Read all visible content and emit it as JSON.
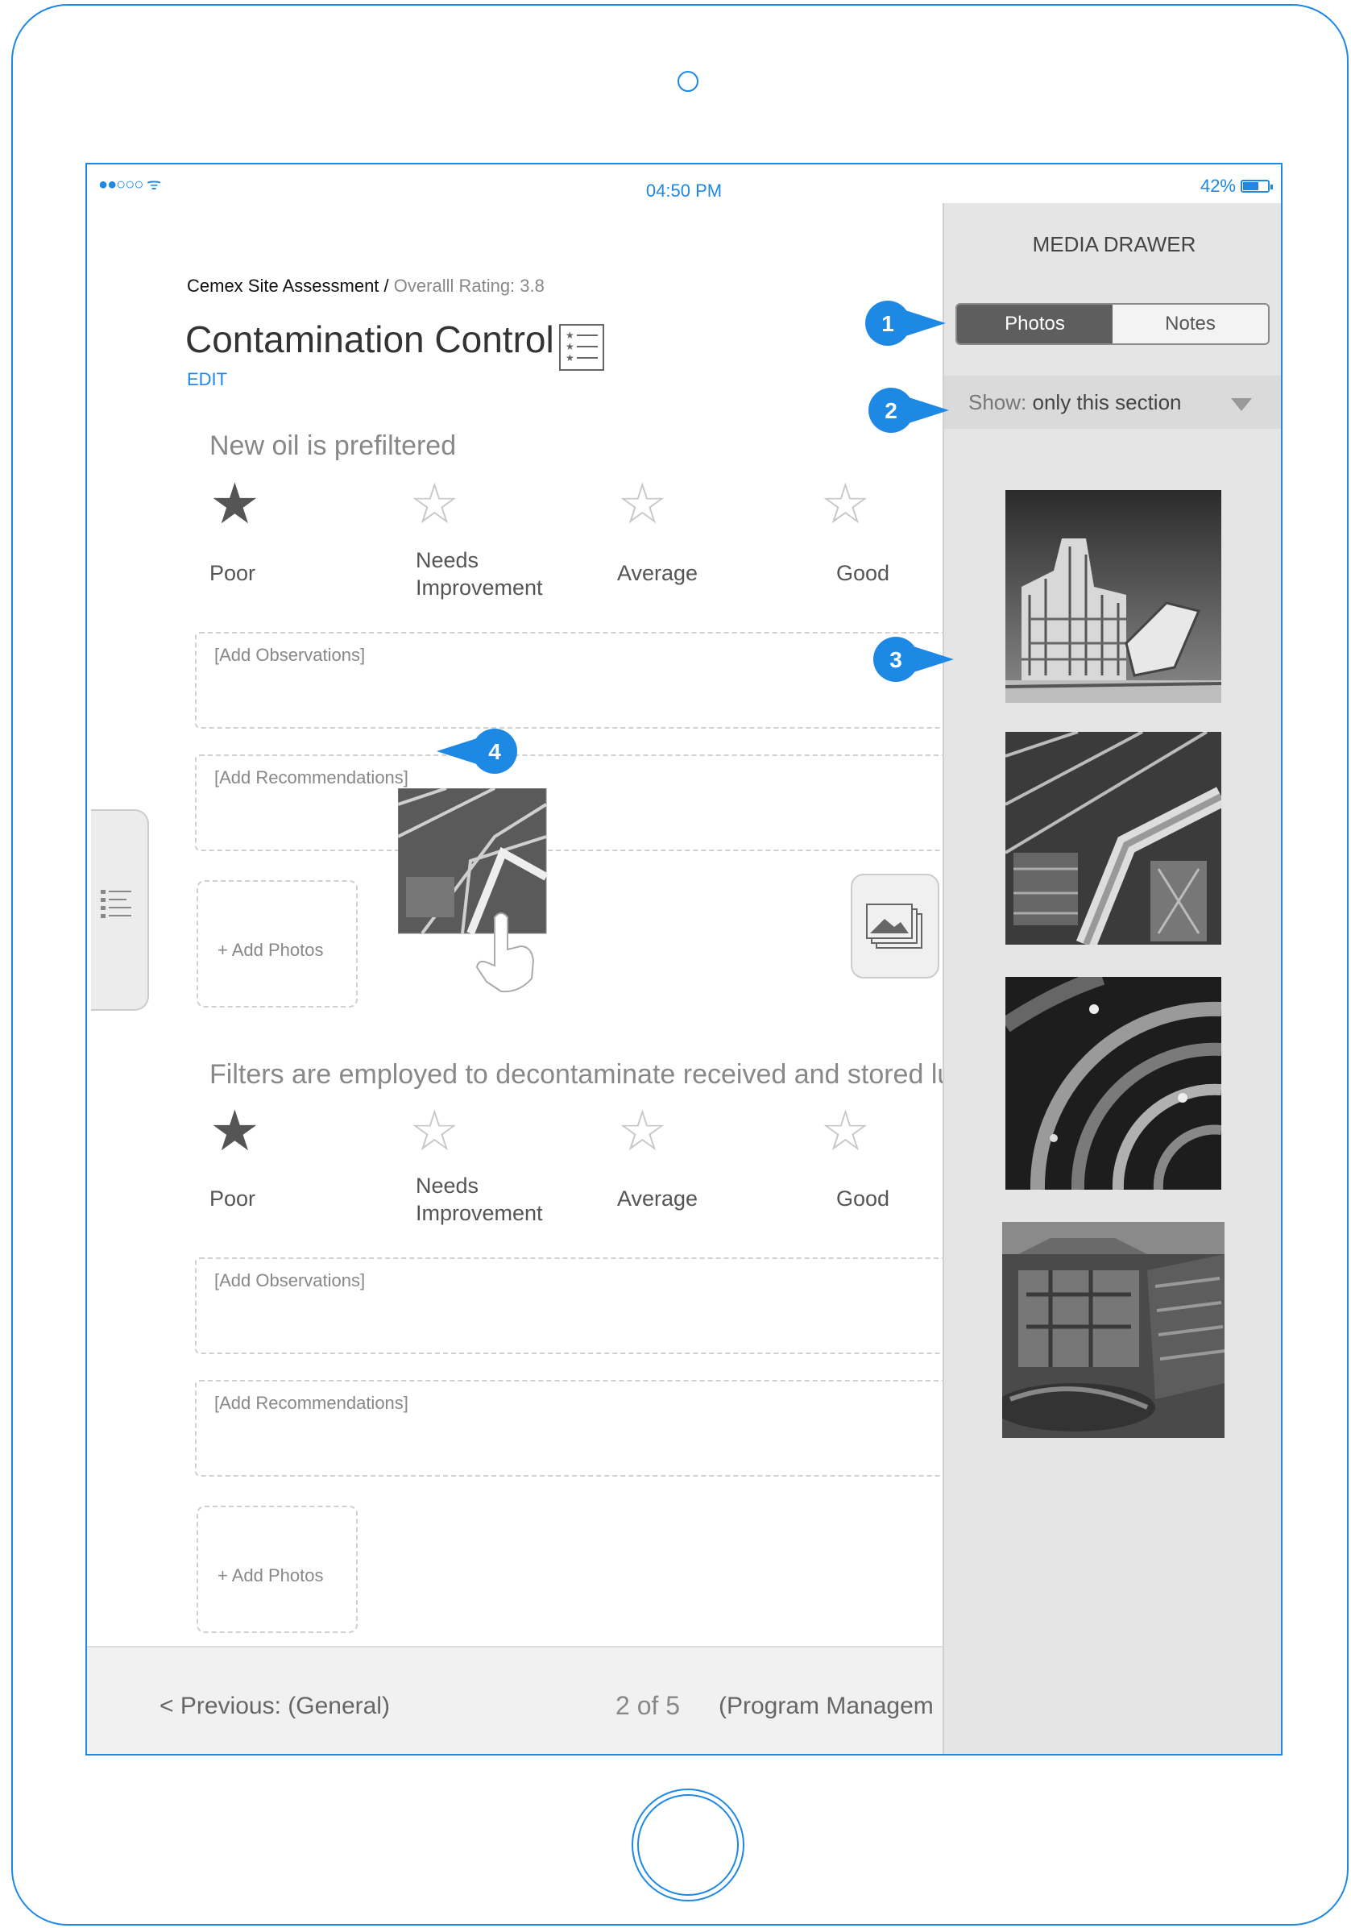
{
  "status_bar": {
    "signal": "●●○○○",
    "wifi": "ᯤ",
    "time": "04:50 PM",
    "battery": "42%"
  },
  "header": {
    "breadcrumb_parent": "Cemex Site Assessment /",
    "overall_rating": "Overalll Rating: 3.8",
    "section_title": "Contamination Control",
    "edit_label": "EDIT"
  },
  "questions": [
    {
      "text": "New oil is prefiltered",
      "ratings": [
        "Poor",
        "Needs Improvement",
        "Average",
        "Good"
      ],
      "observations_placeholder": "[Add Observations]",
      "recommendations_placeholder": "[Add Recommendations]",
      "add_photos_label": "+ Add Photos"
    },
    {
      "text": "Filters are employed to decontaminate received and stored lul",
      "ratings": [
        "Poor",
        "Needs Improvement",
        "Average",
        "Good"
      ],
      "observations_placeholder": "[Add Observations]",
      "recommendations_placeholder": "[Add Recommendations]",
      "add_photos_label": "+ Add Photos"
    }
  ],
  "footer": {
    "previous": "< Previous: (General)",
    "page": "2 of 5",
    "next": "(Program Managem"
  },
  "drawer": {
    "title": "MEDIA DRAWER",
    "tabs": [
      "Photos",
      "Notes"
    ],
    "show_prefix": "Show:",
    "show_value": "only this section"
  },
  "callouts": [
    "1",
    "2",
    "3",
    "4"
  ],
  "colors": {
    "accent": "#1e88e5",
    "drawer_bg": "#e5e5e5",
    "active_tab": "#5e5e5e"
  }
}
